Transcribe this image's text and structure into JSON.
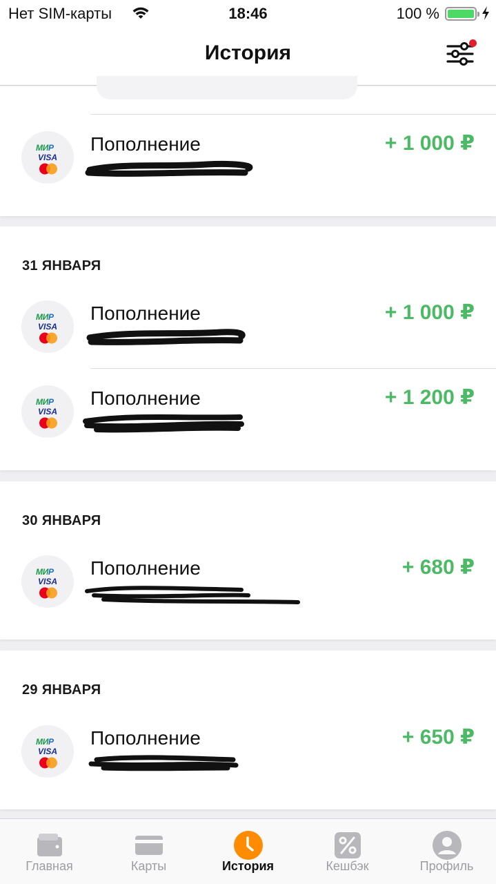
{
  "status_bar": {
    "carrier": "Нет SIM-карты",
    "time": "18:46",
    "battery": "100 %"
  },
  "header": {
    "title": "История"
  },
  "colors": {
    "amount_positive": "#4cba64",
    "tab_active": "#ff8c00",
    "tab_inactive": "#b8b8bc",
    "filter_badge": "#e0202a"
  },
  "groups": [
    {
      "date": "",
      "transactions": [
        {
          "label": "Пополнение",
          "amount": "+ 1 000 ₽",
          "icon": "payment-system-icon"
        }
      ]
    },
    {
      "date": "31 ЯНВАРЯ",
      "transactions": [
        {
          "label": "Пополнение",
          "amount": "+ 1 000 ₽",
          "icon": "payment-system-icon"
        },
        {
          "label": "Пополнение",
          "amount": "+ 1 200 ₽",
          "icon": "payment-system-icon"
        }
      ]
    },
    {
      "date": "30 ЯНВАРЯ",
      "transactions": [
        {
          "label": "Пополнение",
          "amount": "+ 680 ₽",
          "icon": "payment-system-icon"
        }
      ]
    },
    {
      "date": "29 ЯНВАРЯ",
      "transactions": [
        {
          "label": "Пополнение",
          "amount": "+ 650 ₽",
          "icon": "payment-system-icon"
        }
      ]
    }
  ],
  "card_logo": {
    "mir_1": "МИ",
    "mir_2": "Р",
    "visa": "VISA"
  },
  "tabbar": {
    "items": [
      {
        "label": "Главная",
        "icon": "wallet-icon",
        "active": false
      },
      {
        "label": "Карты",
        "icon": "card-icon",
        "active": false
      },
      {
        "label": "История",
        "icon": "clock-icon",
        "active": true
      },
      {
        "label": "Кешбэк",
        "icon": "percent-icon",
        "active": false
      },
      {
        "label": "Профиль",
        "icon": "profile-icon",
        "active": false
      }
    ]
  }
}
